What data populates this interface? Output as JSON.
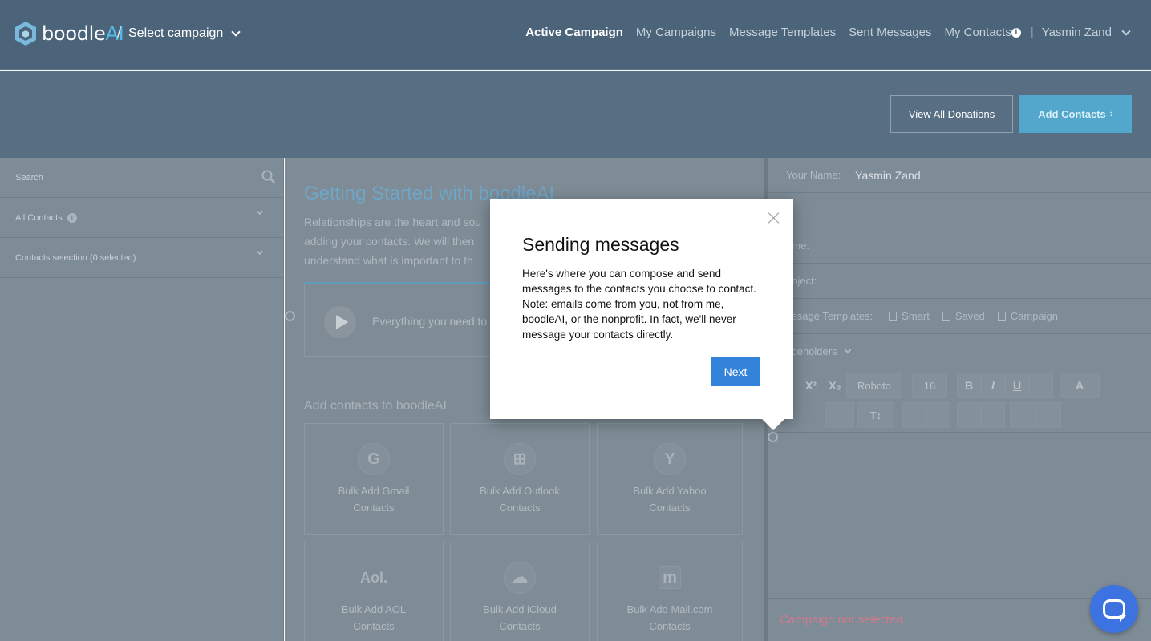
{
  "header": {
    "logo_text_main": "boodle",
    "logo_text_ai": "AI",
    "breadcrumb_sep": "/",
    "campaign_select": "Select campaign",
    "nav": [
      {
        "label": "Active Campaign",
        "active": true
      },
      {
        "label": "My Campaigns",
        "active": false
      },
      {
        "label": "Message Templates",
        "active": false
      },
      {
        "label": "Sent Messages",
        "active": false
      },
      {
        "label": "My Contacts",
        "active": false
      }
    ],
    "info_glyph": "i",
    "nav_separator": "|",
    "user_name": "Yasmin Zand"
  },
  "subbar": {
    "view_donations": "View All Donations",
    "add_contacts": "Add Contacts",
    "add_contacts_suffix": "↕"
  },
  "sidebar": {
    "search_placeholder": "Search",
    "all_contacts": "All Contacts",
    "info_glyph": "i",
    "contacts_selection": "Contacts selection (0 selected)"
  },
  "main": {
    "title": "Getting Started with boodleAI",
    "description": "Relationships are the heart and soul ... adding your contacts. We will then ... understand what is important to th...",
    "desc_line1": "Relationships are the heart and sou",
    "desc_line2": "adding your contacts. We will then",
    "desc_line3": "understand what is important to th",
    "video_text": "Everything you need to",
    "section_title": "Add contacts to boodleAI",
    "tiles": [
      {
        "icon": "G",
        "line1": "Bulk Add Gmail",
        "line2": "Contacts"
      },
      {
        "icon": "⊞",
        "line1": "Bulk Add Outlook",
        "line2": "Contacts"
      },
      {
        "icon": "Y",
        "line1": "Bulk Add Yahoo",
        "line2": "Contacts"
      },
      {
        "icon": "Aol.",
        "line1": "Bulk Add AOL",
        "line2": "Contacts"
      },
      {
        "icon": "☁",
        "line1": "Bulk Add iCloud",
        "line2": "Contacts"
      },
      {
        "icon": "m",
        "line1": "Bulk Add Mail.com",
        "line2": "Contacts"
      }
    ]
  },
  "compose": {
    "your_name_label": "Your Name:",
    "your_name_value": "Yasmin Zand",
    "row2_label": ":",
    "row3_label": "ame:",
    "subject_label": "ubject:",
    "templates_label": "essage Templates:",
    "template_smart": "Smart",
    "template_saved": "Saved",
    "template_campaign": "Campaign",
    "placeholders": "aceholders",
    "toolbar": {
      "sup": "X²",
      "sub": "X₂",
      "font": "Roboto",
      "size": "16",
      "bold": "B",
      "italic": "I",
      "underline": "U",
      "color": "A",
      "textsize": "T↕"
    },
    "status": "Campaign not selected."
  },
  "modal": {
    "title": "Sending messages",
    "body": "Here's where you can compose and send messages to the contacts you choose to contact. Note: emails come from you, not from me, boodleAI, or the nonprofit. In fact, we'll never message your contacts directly.",
    "next": "Next"
  },
  "colors": {
    "header_bg": "#4b6479",
    "accent_blue": "#3483db",
    "chat_blue": "#3c73e0",
    "status_red": "#d07a8b"
  }
}
